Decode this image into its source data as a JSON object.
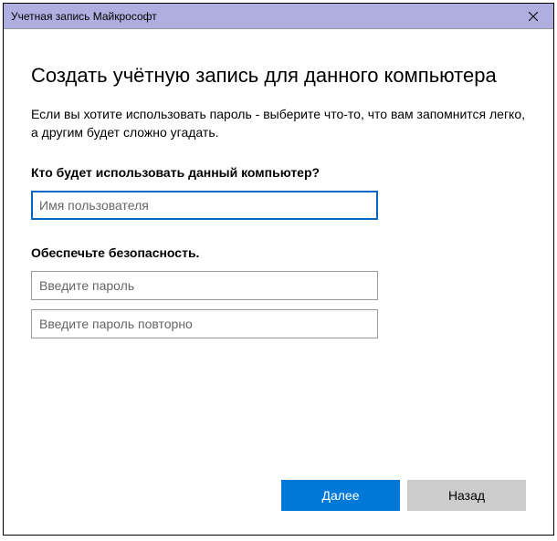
{
  "titlebar": {
    "title": "Учетная запись Майкрософт"
  },
  "main": {
    "heading": "Создать учётную запись для данного компьютера",
    "description": "Если вы хотите использовать пароль - выберите что-то, что вам запомнится легко, а другим будет сложно угадать.",
    "section_user": {
      "label": "Кто будет использовать данный компьютер?",
      "username_placeholder": "Имя пользователя"
    },
    "section_security": {
      "label": "Обеспечьте безопасность.",
      "password_placeholder": "Введите пароль",
      "password_confirm_placeholder": "Введите пароль повторно"
    }
  },
  "footer": {
    "next_label": "Далее",
    "back_label": "Назад"
  }
}
